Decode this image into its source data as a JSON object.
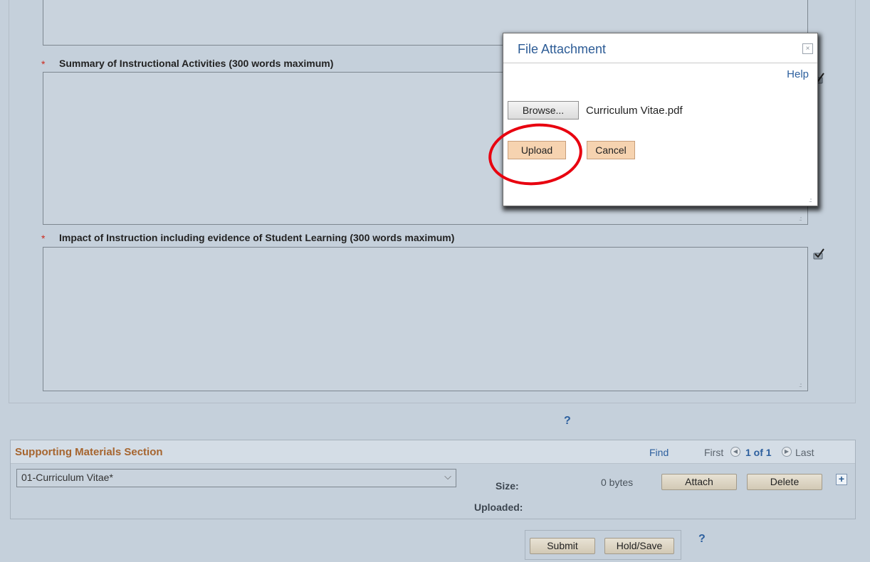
{
  "form": {
    "required_marker": "*",
    "summary_label": "Summary of Instructional Activities (300 words maximum)",
    "impact_label": "Impact of Instruction including evidence of Student Learning (300 words maximum)",
    "help_symbol": "?"
  },
  "modal": {
    "title": "File Attachment",
    "close_glyph": "×",
    "help_link": "Help",
    "browse_label": "Browse...",
    "file_name": "Curriculum Vitae.pdf",
    "upload_label": "Upload",
    "cancel_label": "Cancel",
    "highlight_color": "#e8000f"
  },
  "supporting": {
    "title": "Supporting Materials Section",
    "find_link": "Find",
    "first_label": "First",
    "page_indicator": "1 of 1",
    "last_label": "Last",
    "selected_material": "01-Curriculum Vitae*",
    "size_label": "Size:",
    "size_value": "0 bytes",
    "uploaded_label": "Uploaded:",
    "attach_label": "Attach",
    "delete_label": "Delete",
    "add_symbol": "+"
  },
  "actions": {
    "submit_label": "Submit",
    "hold_save_label": "Hold/Save",
    "help_symbol": "?"
  },
  "icons": {
    "spellcheck": "spellcheck-icon",
    "previous": "previous-arrow-icon",
    "next": "next-arrow-icon",
    "dropdown": "chevron-down-icon",
    "close": "close-icon",
    "add": "plus-icon"
  },
  "colors": {
    "page_bg": "#c5d0db",
    "section_title": "#a6652f",
    "link": "#2c5f9e",
    "required": "#cc2a1e",
    "upload_button": "#f6d3b0"
  }
}
